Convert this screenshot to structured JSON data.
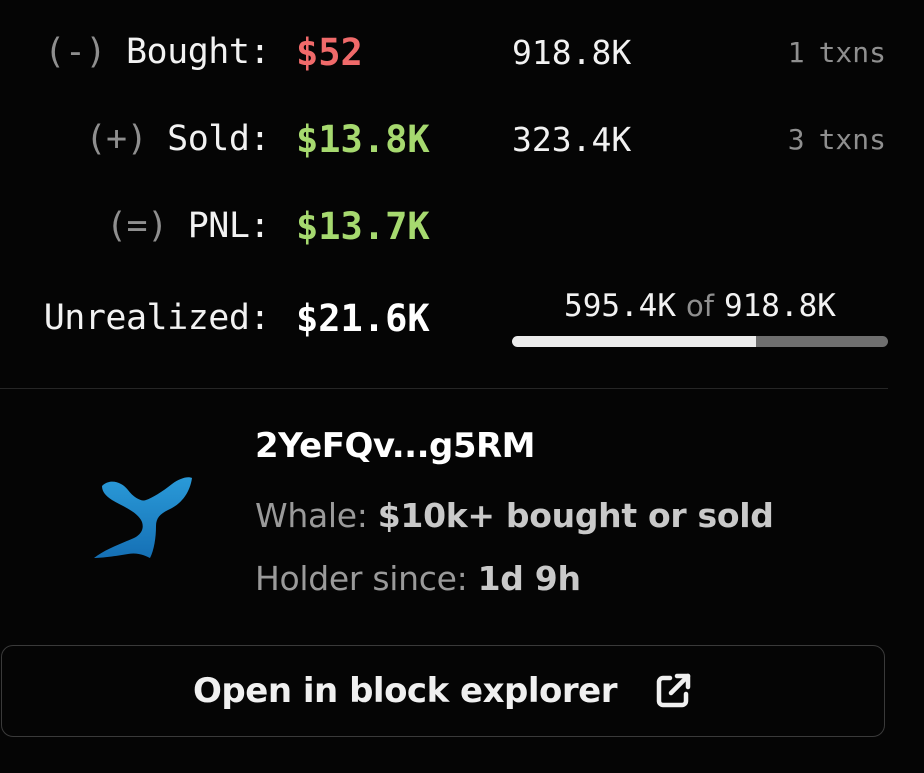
{
  "stats": {
    "bought": {
      "sign": "(-)",
      "label": "Bought:",
      "usd": "$52",
      "amount": "918.8K",
      "txn_count": "1",
      "txn_unit": "txns",
      "usd_color": "#f06a6a"
    },
    "sold": {
      "sign": "(+)",
      "label": "Sold:",
      "usd": "$13.8K",
      "amount": "323.4K",
      "txn_count": "3",
      "txn_unit": "txns",
      "usd_color": "#a6d96f"
    },
    "pnl": {
      "sign": "(=)",
      "label": "PNL:",
      "usd": "$13.7K",
      "usd_color": "#a6d96f"
    },
    "unrealized": {
      "label": "Unrealized:",
      "usd": "$21.6K",
      "held": "595.4K",
      "of_word": "of",
      "total": "918.8K",
      "held_fraction": 0.648
    }
  },
  "wallet": {
    "icon": "whale-tail-icon",
    "icon_color": "#1f86c9",
    "address": "2YeFQv...g5RM",
    "whale_label": "Whale:",
    "whale_value": "$10k+ bought or sold",
    "holder_label": "Holder since:",
    "holder_value": "1d 9h"
  },
  "explorer_button": {
    "label": "Open in block explorer",
    "icon": "external-link-icon"
  }
}
